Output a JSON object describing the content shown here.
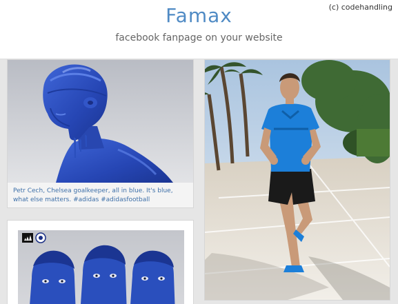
{
  "header": {
    "title": "Famax",
    "subtitle": "facebook fanpage on your website",
    "copyright": "(c) codehandling"
  },
  "posts": [
    {
      "caption": "Petr Cech, Chelsea goalkeeper, all in blue. It's blue, what else matters. #adidas #adidasfootball",
      "image": "blue-painted-goalkeeper-photo"
    },
    {
      "image": "blue-painted-players-photo",
      "badges": [
        "adidas-logo-icon",
        "chelsea-crest-icon"
      ]
    },
    {
      "image": "footballer-running-photo"
    }
  ],
  "colors": {
    "accent": "#4f8ac4",
    "caption_link": "#3d6fa8",
    "background": "#e6e6e6",
    "paint_blue": "#2a4fbd"
  }
}
